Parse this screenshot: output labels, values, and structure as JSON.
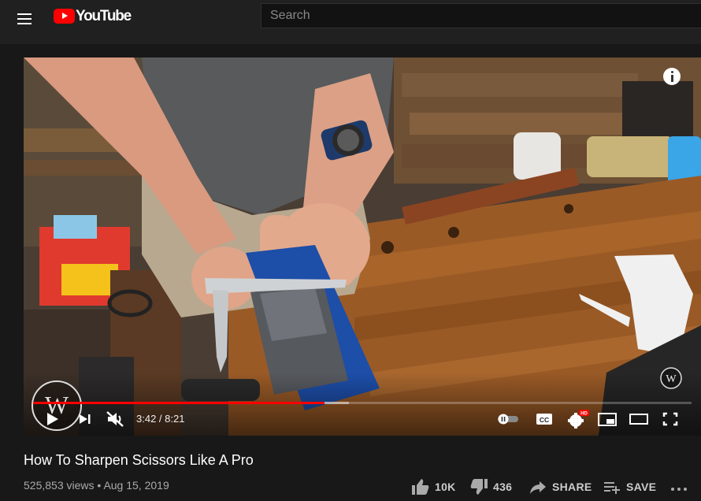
{
  "header": {
    "logo_text": "YouTube",
    "search_placeholder": "Search",
    "menu_icon": "hamburger-menu-icon",
    "logo_icon": "youtube-logo-icon"
  },
  "player": {
    "current_time": "3:42",
    "duration": "8:21",
    "played_fraction": 0.443,
    "buffered_fraction": 0.48,
    "hd_badge": "HD",
    "muted": true,
    "watermark_text": "W"
  },
  "video": {
    "title": "How To Sharpen Scissors Like A Pro",
    "views": "525,853 views",
    "separator": "•",
    "date": "Aug 15, 2019"
  },
  "actions": {
    "like_count": "10K",
    "dislike_count": "436",
    "share_label": "SHARE",
    "save_label": "SAVE"
  },
  "colors": {
    "accent": "#ff0000",
    "background": "#181818",
    "header": "#202020"
  }
}
